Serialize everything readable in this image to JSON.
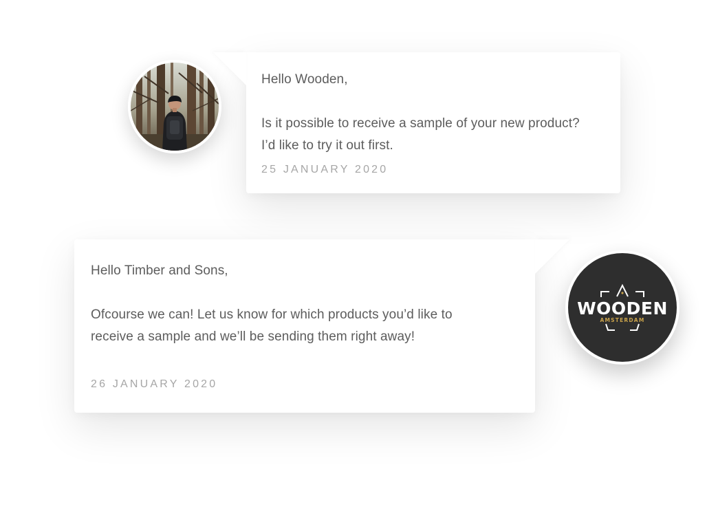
{
  "messages": [
    {
      "greeting": "Hello Wooden,",
      "body_line1": "Is it possible to receive a sample of your new product?",
      "body_line2": "I’d like to try it out first.",
      "date": "25 JANUARY 2020"
    },
    {
      "greeting": "Hello Timber and Sons,",
      "body_line1": "Ofcourse we can! Let us know for which products you’d like to",
      "body_line2": "receive a sample and we’ll be sending them right away!",
      "date": "26 JANUARY 2020"
    }
  ],
  "brand": {
    "name": "WOODEN",
    "location": "AMSTERDAM"
  },
  "colors": {
    "text": "#5c5c5c",
    "date": "#a6a6a6",
    "brand_bg": "#2e2e2e",
    "brand_accent": "#c9a24a"
  },
  "icons": {
    "user_avatar": "hiker-forest-photo",
    "brand_logo": "wooden-amsterdam-logo"
  }
}
